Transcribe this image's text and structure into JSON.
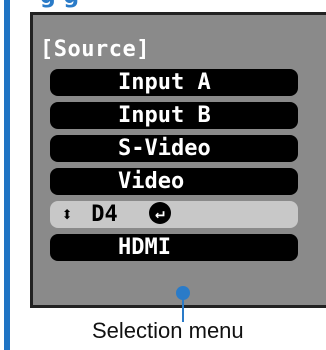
{
  "header": {
    "title_partial": "g g"
  },
  "menu": {
    "heading": "[Source]",
    "items": [
      {
        "label": "Input A",
        "selected": false
      },
      {
        "label": "Input B",
        "selected": false
      },
      {
        "label": "S-Video",
        "selected": false
      },
      {
        "label": "Video",
        "selected": false
      },
      {
        "label": "D4",
        "selected": true
      },
      {
        "label": "HDMI",
        "selected": false
      }
    ],
    "selected_arrow_icon": "up-down-arrow",
    "enter_icon": "enter-return-icon"
  },
  "caption": "Selection menu",
  "colors": {
    "accent": "#2a7bc8",
    "panel": "#8a8a8a",
    "selected_row": "#c8c8c8"
  }
}
